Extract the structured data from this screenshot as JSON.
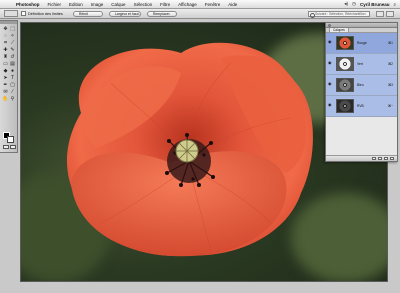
{
  "menubar": {
    "apple_icon": "apple-icon",
    "app_name": "Photoshop",
    "items": [
      "Fichier",
      "Edition",
      "Image",
      "Calque",
      "Sélection",
      "Filtre",
      "Affichage",
      "Fenêtre",
      "Aide"
    ],
    "user": "Cyril Bruneau"
  },
  "options": {
    "checkbox_label": "Définition des limites",
    "buttons": [
      "Réinit",
      "Largeur et haut.",
      "Remplacer"
    ],
    "search_placeholder": "Suivant : Sélection, Rééchantillon"
  },
  "layers": {
    "tabs": [
      "Calques"
    ],
    "rows": [
      {
        "name": "Rouge",
        "shortcut": "⌘1",
        "thumb": "red"
      },
      {
        "name": "Vert",
        "shortcut": "⌘2",
        "thumb": "green"
      },
      {
        "name": "Bleu",
        "shortcut": "⌘3",
        "thumb": "blue"
      },
      {
        "name": "RVB",
        "shortcut": "⌘~",
        "thumb": "rgb"
      }
    ]
  },
  "colors": {
    "foreground": "#000000",
    "background": "#ffffff",
    "petal": "#e2553a",
    "selection": "#8fa7dc"
  }
}
